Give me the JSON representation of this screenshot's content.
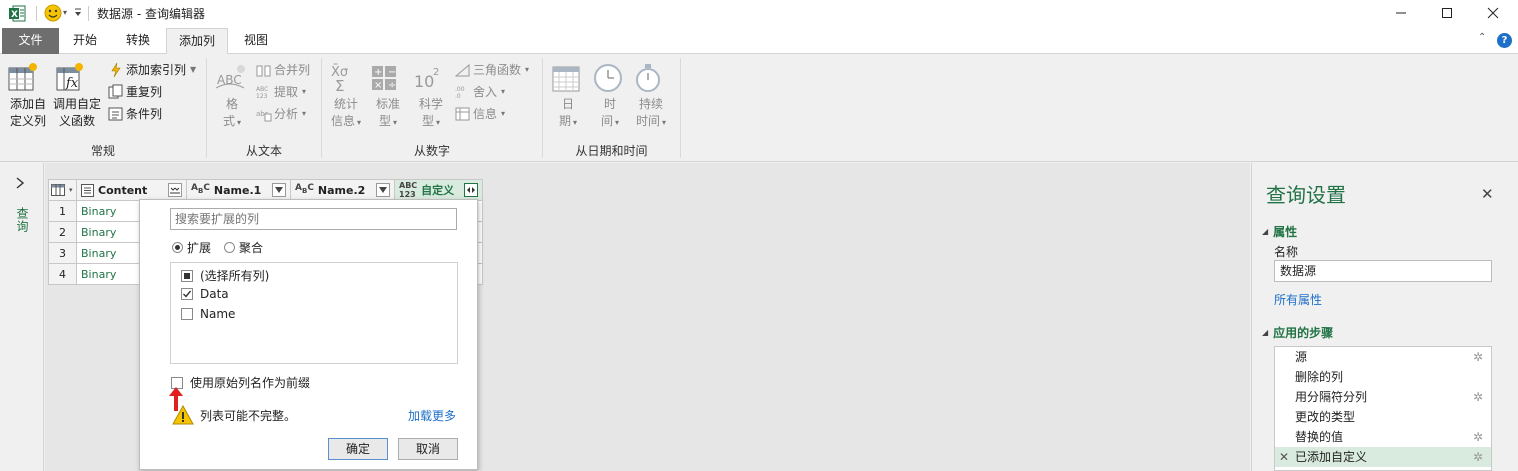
{
  "window": {
    "title": "数据源 - 查询编辑器"
  },
  "tabs": [
    {
      "label": "文件"
    },
    {
      "label": "开始"
    },
    {
      "label": "转换"
    },
    {
      "label": "添加列"
    },
    {
      "label": "视图"
    }
  ],
  "ribbon": {
    "general": {
      "label": "常规",
      "add_custom_col_line1": "添加自",
      "add_custom_col_line2": "定义列",
      "invoke_fn_line1": "调用自定",
      "invoke_fn_line2": "义函数",
      "index_col": "添加索引列",
      "dup_col": "重复列",
      "cond_col": "条件列"
    },
    "from_text": {
      "label": "从文本",
      "format_line1": "格",
      "format_line2": "式",
      "merge_cols": "合并列",
      "extract": "提取",
      "parse": "分析"
    },
    "from_number": {
      "label": "从数字",
      "stats_line1": "统计",
      "stats_line2": "信息",
      "standard_line1": "标准",
      "standard_line2": "型",
      "sci_line1": "科学",
      "sci_line2": "型",
      "trig": "三角函数",
      "round": "舍入",
      "info": "信息"
    },
    "from_datetime": {
      "label": "从日期和时间",
      "date_line1": "日",
      "date_line2": "期",
      "time_line1": "时",
      "time_line2": "间",
      "dur_line1": "持续",
      "dur_line2": "时间"
    }
  },
  "left_pane": {
    "label": "查询"
  },
  "grid": {
    "columns": [
      {
        "name": "Content",
        "type": "binary"
      },
      {
        "name": "Name.1",
        "type": "text"
      },
      {
        "name": "Name.2",
        "type": "text"
      },
      {
        "name": "自定义",
        "type": "any"
      }
    ],
    "rows": [
      {
        "n": "1",
        "content": "Binary"
      },
      {
        "n": "2",
        "content": "Binary"
      },
      {
        "n": "3",
        "content": "Binary"
      },
      {
        "n": "4",
        "content": "Binary"
      }
    ]
  },
  "popup": {
    "search_placeholder": "搜索要扩展的列",
    "radio_expand": "扩展",
    "radio_aggregate": "聚合",
    "items": [
      {
        "label": "(选择所有列)",
        "state": "partial"
      },
      {
        "label": "Data",
        "state": "checked"
      },
      {
        "label": "Name",
        "state": "unchecked"
      }
    ],
    "prefix_label": "使用原始列名作为前缀",
    "warning": "列表可能不完整。",
    "load_more": "加载更多",
    "ok": "确定",
    "cancel": "取消"
  },
  "query_settings": {
    "title": "查询设置",
    "properties_label": "属性",
    "name_label": "名称",
    "name_value": "数据源",
    "all_props": "所有属性",
    "steps_label": "应用的步骤",
    "steps": [
      {
        "label": "源",
        "gear": true,
        "selected": false
      },
      {
        "label": "删除的列",
        "gear": false,
        "selected": false
      },
      {
        "label": "用分隔符分列",
        "gear": true,
        "selected": false
      },
      {
        "label": "更改的类型",
        "gear": false,
        "selected": false
      },
      {
        "label": "替换的值",
        "gear": true,
        "selected": false
      },
      {
        "label": "已添加自定义",
        "gear": true,
        "selected": true
      }
    ]
  },
  "colors": {
    "accent_green": "#217346",
    "file_tab": "#6e6e6e",
    "selected_step": "#d9ebde",
    "arrow_red": "#e02020"
  }
}
